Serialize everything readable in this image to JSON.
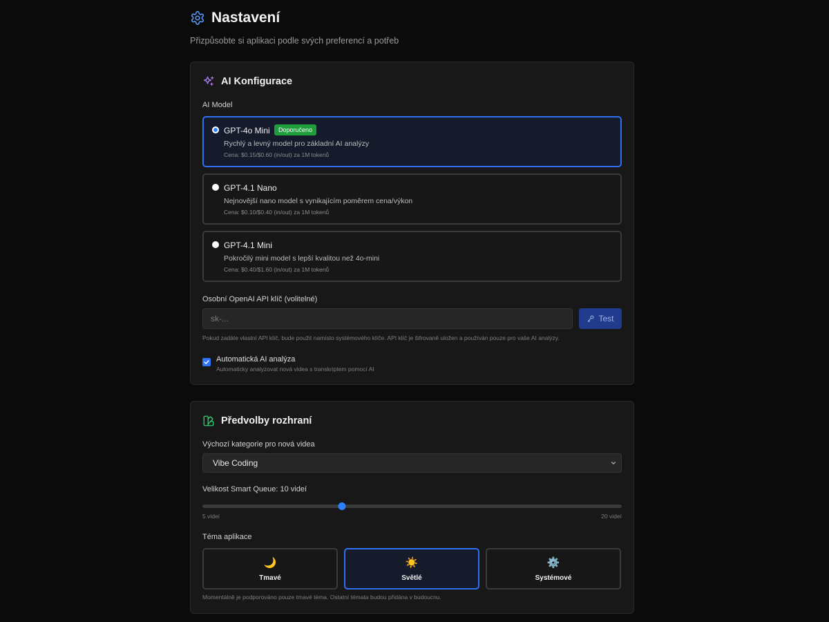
{
  "header": {
    "title": "Nastavení",
    "subtitle": "Přizpůsobte si aplikaci podle svých preferencí a potřeb",
    "icon": "gear-icon"
  },
  "ai_config": {
    "title": "AI Konfigurace",
    "icon": "sparkles-icon",
    "model_label": "AI Model",
    "models": [
      {
        "name": "GPT-4o Mini",
        "badge": "Doporučeno",
        "description": "Rychlý a levný model pro základní AI analýzy",
        "price": "Cena: $0.15/$0.60 (in/out) za 1M tokenů",
        "selected": true
      },
      {
        "name": "GPT-4.1 Nano",
        "badge": "",
        "description": "Nejnovější nano model s vynikajícím poměrem cena/výkon",
        "price": "Cena: $0.10/$0.40 (in/out) za 1M tokenů",
        "selected": false
      },
      {
        "name": "GPT-4.1 Mini",
        "badge": "",
        "description": "Pokročilý mini model s lepší kvalitou než 4o-mini",
        "price": "Cena: $0.40/$1.60 (in/out) za 1M tokenů",
        "selected": false
      }
    ],
    "api_key_label": "Osobní OpenAI API klíč (volitelné)",
    "api_key_placeholder": "sk-...",
    "api_key_value": "",
    "test_button": "Test",
    "api_hint": "Pokud zadáte vlastní API klíč, bude použit namísto systémového klíče. API klíč je šifrovaně uložen a používán pouze pro vaše AI analýzy.",
    "auto_label": "Automatická AI analýza",
    "auto_description": "Automaticky analyzovat nová videa s transkriptem pomocí AI",
    "auto_checked": true
  },
  "ui_prefs": {
    "title": "Předvolby rozhraní",
    "icon": "palette-icon",
    "category_label": "Výchozí kategorie pro nová videa",
    "category_value": "Vibe Coding",
    "queue_label": "Velikost Smart Queue: 10 videí",
    "queue_value": 10,
    "queue_min": 5,
    "queue_max": 20,
    "queue_min_label": "5 videí",
    "queue_max_label": "20 videí",
    "theme_label": "Téma aplikace",
    "themes": [
      {
        "label": "Tmavé",
        "emoji": "🌙",
        "icon": "moon-icon",
        "selected": false
      },
      {
        "label": "Světlé",
        "emoji": "☀️",
        "icon": "sun-icon",
        "selected": true
      },
      {
        "label": "Systémové",
        "emoji": "⚙️",
        "icon": "gear-icon",
        "selected": false
      }
    ],
    "theme_hint": "Momentálně je podporováno pouze tmavé téma. Ostatní témata budou přidána v budoucnu."
  },
  "colors": {
    "accent": "#2f6ff2",
    "badge": "#1f9d3c",
    "background": "#0b0b0b",
    "card": "#181818"
  }
}
